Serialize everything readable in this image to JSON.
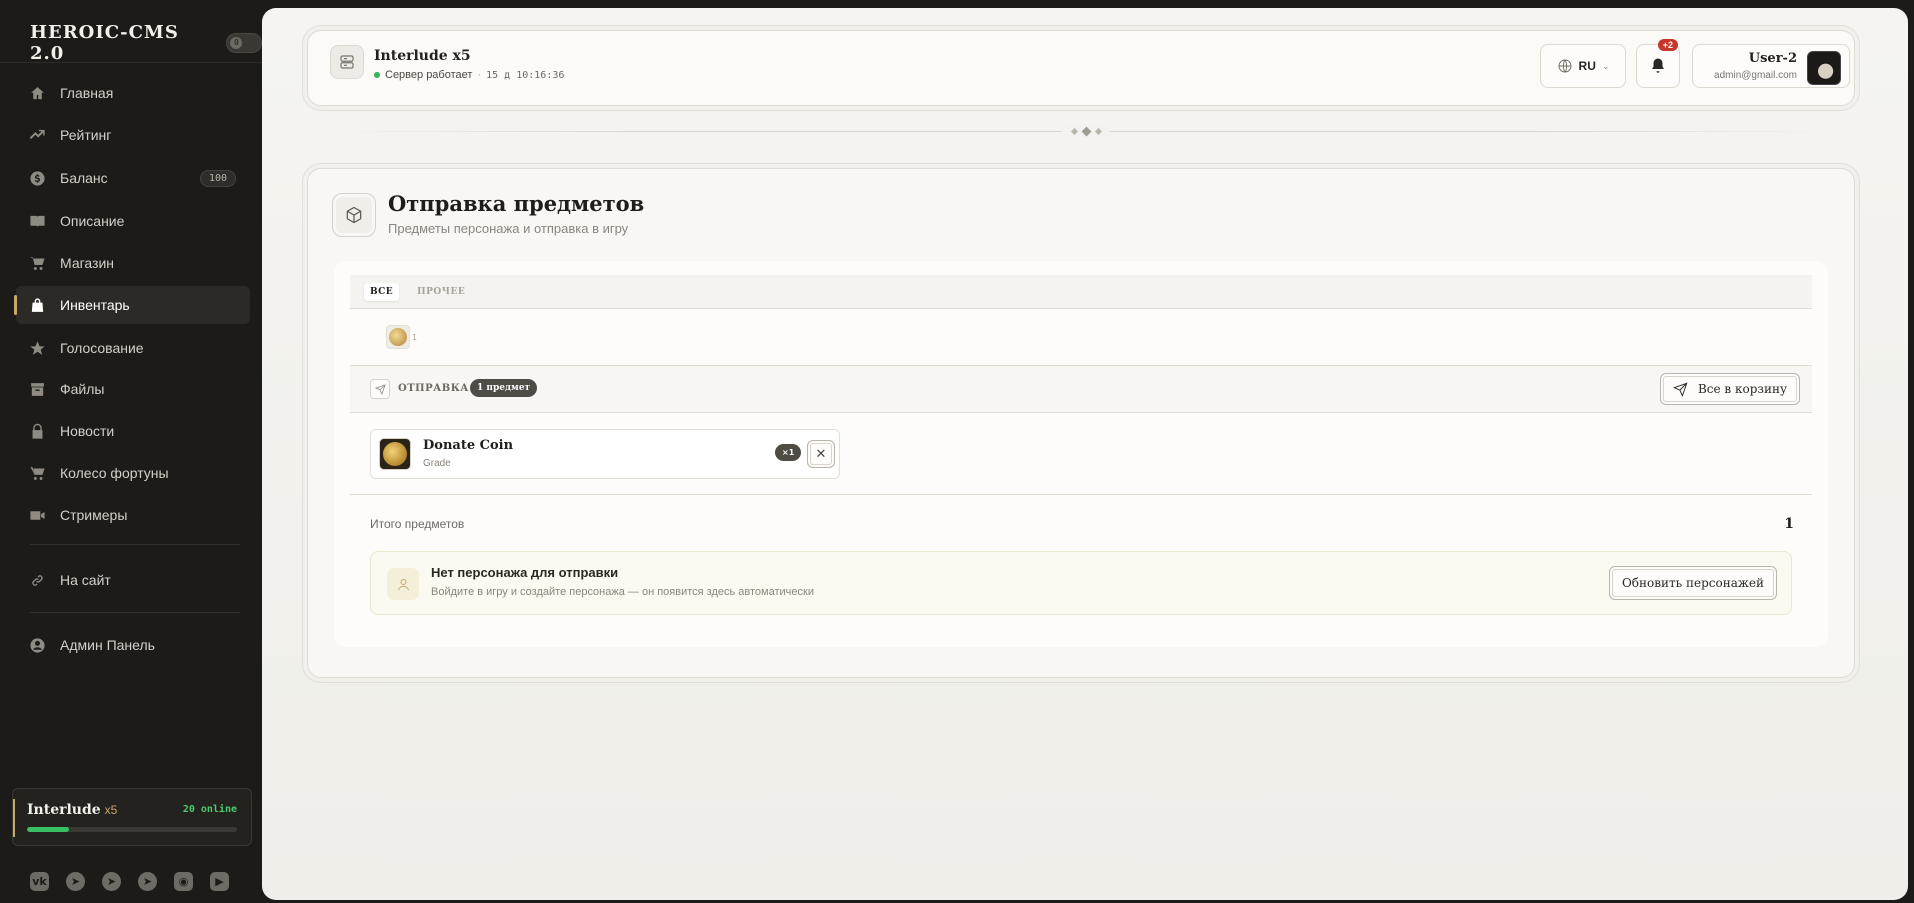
{
  "brand": {
    "title": "HEROIC-CMS 2.0",
    "toggle_value": "0"
  },
  "sidebar": {
    "items": [
      {
        "label": "Главная",
        "icon": "home-icon"
      },
      {
        "label": "Рейтинг",
        "icon": "trending-icon"
      },
      {
        "label": "Баланс",
        "icon": "dollar-icon",
        "badge": "100"
      },
      {
        "label": "Описание",
        "icon": "book-icon"
      },
      {
        "label": "Магазин",
        "icon": "cart-icon"
      },
      {
        "label": "Инвентарь",
        "icon": "bag-icon",
        "active": true
      },
      {
        "label": "Голосование",
        "icon": "star-icon"
      },
      {
        "label": "Файлы",
        "icon": "archive-icon"
      },
      {
        "label": "Новости",
        "icon": "lock-icon"
      },
      {
        "label": "Колесо фортуны",
        "icon": "cart-icon"
      },
      {
        "label": "Стримеры",
        "icon": "video-icon"
      }
    ],
    "site_link": {
      "label": "На сайт",
      "icon": "link-icon"
    },
    "admin_link": {
      "label": "Админ Панель",
      "icon": "user-circle-icon"
    },
    "server": {
      "name": "Interlude",
      "rate": "x5",
      "online": "20 online",
      "load_fraction": 0.2
    },
    "socials": [
      "vk-icon",
      "telegram-icon",
      "telegram-icon",
      "telegram-icon",
      "discord-icon",
      "youtube-icon"
    ]
  },
  "topbar": {
    "server_title": "Interlude x5",
    "status": "Сервер работает",
    "uptime": "15 д 10:16:36",
    "language": "RU",
    "notifications_badge": "+2",
    "user_name": "User-2",
    "user_email": "admin@gmail.com"
  },
  "page": {
    "title": "Отправка предметов",
    "subtitle": "Предметы персонажа и отправка в игру"
  },
  "tabs": [
    {
      "label": "ВСЕ",
      "active": true
    },
    {
      "label": "ПРОЧЕЕ",
      "active": false
    }
  ],
  "inventory": {
    "slot_count": "1"
  },
  "send": {
    "label": "ОТПРАВКА",
    "count_badge": "1 предмет",
    "all_to_cart": "Все в корзину",
    "item": {
      "name": "Donate Coin",
      "grade": "Grade",
      "qty": "×1"
    }
  },
  "total": {
    "label": "Итого предметов",
    "value": "1"
  },
  "notice": {
    "title": "Нет персонажа для отправки",
    "text": "Войдите в игру и создайте персонажа — он появится здесь автоматически",
    "button": "Обновить персонажей"
  },
  "colors": {
    "accent": "#c9a86a",
    "online": "#39c062",
    "badge_red": "#c5372a",
    "sidebar_bg": "#1c1b18"
  }
}
